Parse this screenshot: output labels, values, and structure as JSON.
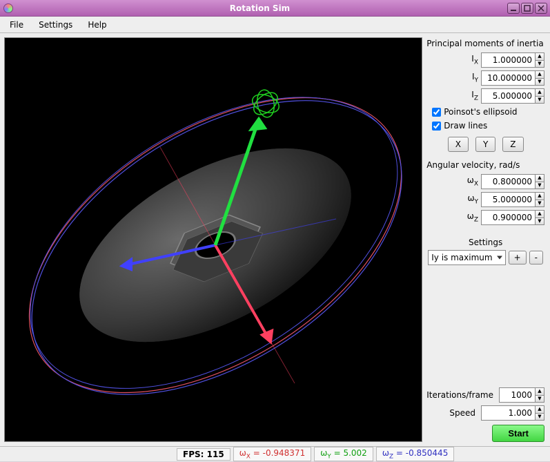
{
  "window": {
    "title": "Rotation Sim"
  },
  "menu": {
    "file": "File",
    "settings": "Settings",
    "help": "Help"
  },
  "inertia": {
    "heading": "Principal moments of inertia",
    "ix_label": "I",
    "ix_sub": "X",
    "ix": "1.000000",
    "iy_label": "I",
    "iy_sub": "Y",
    "iy": "10.000000",
    "iz_label": "I",
    "iz_sub": "Z",
    "iz": "5.000000",
    "poinsot_label": "Poinsot's ellipsoid",
    "poinsot_checked": true,
    "drawlines_label": "Draw lines",
    "drawlines_checked": true,
    "btn_x": "X",
    "btn_y": "Y",
    "btn_z": "Z"
  },
  "angvel": {
    "heading": "Angular velocity, rad/s",
    "wx_label": "ω",
    "wx_sub": "X",
    "wx": "0.800000",
    "wy_label": "ω",
    "wy_sub": "Y",
    "wy": "5.000000",
    "wz_label": "ω",
    "wz_sub": "Z",
    "wz": "0.900000"
  },
  "settings": {
    "heading": "Settings",
    "selected": "Iy is maximum",
    "plus": "+",
    "minus": "-"
  },
  "run": {
    "iter_label": "Iterations/frame",
    "iter": "1000",
    "speed_label": "Speed",
    "speed": "1.000",
    "start": "Start"
  },
  "status": {
    "fps_label": "FPS:",
    "fps": "115",
    "wx_label": "ω",
    "wx_sub": "X",
    "wx": "-0.948371",
    "wy_label": "ω",
    "wy_sub": "Y",
    "wy": "5.002",
    "wz_label": "ω",
    "wz_sub": "Z",
    "wz": "-0.850445"
  },
  "colors": {
    "axis_x": "#ff4060",
    "axis_y": "#20e040",
    "axis_z": "#4040ff",
    "ellipsoid": "#4a4a4a",
    "ring_red": "#e05060",
    "ring_blue": "#5050e0",
    "trail": "#20d020"
  }
}
